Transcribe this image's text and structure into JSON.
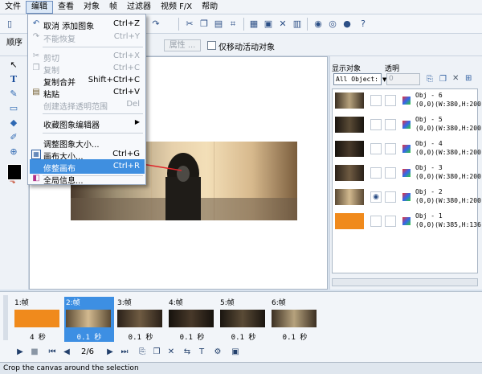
{
  "menubar": [
    "文件",
    "编辑",
    "查看",
    "对象",
    "帧",
    "过滤器",
    "视频 F/X",
    "帮助"
  ],
  "propbar": {
    "panel_label": "顺序",
    "properties_button": "属性 ...",
    "move_active_checkbox": "仅移动活动对象"
  },
  "dropdown": {
    "items": [
      {
        "label": "取消 添加图象",
        "shortcut": "Ctrl+Z",
        "icon": "undo-icon",
        "disabled": false
      },
      {
        "label": "不能恢复",
        "shortcut": "Ctrl+Y",
        "icon": "redo-icon",
        "disabled": true
      },
      {
        "label": "剪切",
        "shortcut": "Ctrl+X",
        "icon": "scissors-icon",
        "disabled": true
      },
      {
        "label": "复制",
        "shortcut": "Ctrl+C",
        "icon": "copy-icon",
        "disabled": true
      },
      {
        "label": "复制合并",
        "shortcut": "Shift+Ctrl+C",
        "icon": "",
        "disabled": false
      },
      {
        "label": "粘贴",
        "shortcut": "Ctrl+V",
        "icon": "paste-icon",
        "disabled": false
      },
      {
        "label": "创建选择透明范围",
        "shortcut": "Del",
        "icon": "",
        "disabled": true
      },
      {
        "label": "收藏图象编辑器",
        "shortcut": "",
        "icon": "",
        "disabled": false,
        "submenu": true
      },
      {
        "label": "调整图象大小...",
        "shortcut": "",
        "icon": "",
        "disabled": false
      },
      {
        "label": "画布大小...",
        "shortcut": "Ctrl+G",
        "icon": "canvas-size-icon",
        "disabled": false
      },
      {
        "label": "修整画布",
        "shortcut": "Ctrl+R",
        "icon": "",
        "disabled": false,
        "highlighted": true
      },
      {
        "label": "全局信息...",
        "shortcut": "",
        "icon": "info-icon",
        "disabled": false
      }
    ]
  },
  "rightpanel": {
    "display_label": "显示对象",
    "opacity_label": "透明",
    "object_select": "All Object:",
    "opacity_value": "0",
    "objects": [
      {
        "name": "Obj - 6",
        "info": "(0,0)(W:380,H:200"
      },
      {
        "name": "Obj - 5",
        "info": "(0,0)(W:380,H:200"
      },
      {
        "name": "Obj - 4",
        "info": "(0,0)(W:380,H:200"
      },
      {
        "name": "Obj - 3",
        "info": "(0,0)(W:380,H:200"
      },
      {
        "name": "Obj - 2",
        "info": "(0,0)(W:380,H:200"
      },
      {
        "name": "Obj - 1",
        "info": "(0,0)(W:385,H:136"
      }
    ]
  },
  "timeline": {
    "frames": [
      {
        "label": "1:帧",
        "time": "4 秒"
      },
      {
        "label": "2:帧",
        "time": "0.1 秒"
      },
      {
        "label": "3:帧",
        "time": "0.1 秒"
      },
      {
        "label": "4:帧",
        "time": "0.1 秒"
      },
      {
        "label": "5:帧",
        "time": "0.1 秒"
      },
      {
        "label": "6:帧",
        "time": "0.1 秒"
      }
    ],
    "selected_index": 1,
    "frame_counter": "2/6"
  },
  "statusbar": "Crop the canvas around the selection",
  "colors": {
    "highlight": "#3f8fe0",
    "arrow": "#e0262a",
    "chrome": "#eef2f7"
  }
}
